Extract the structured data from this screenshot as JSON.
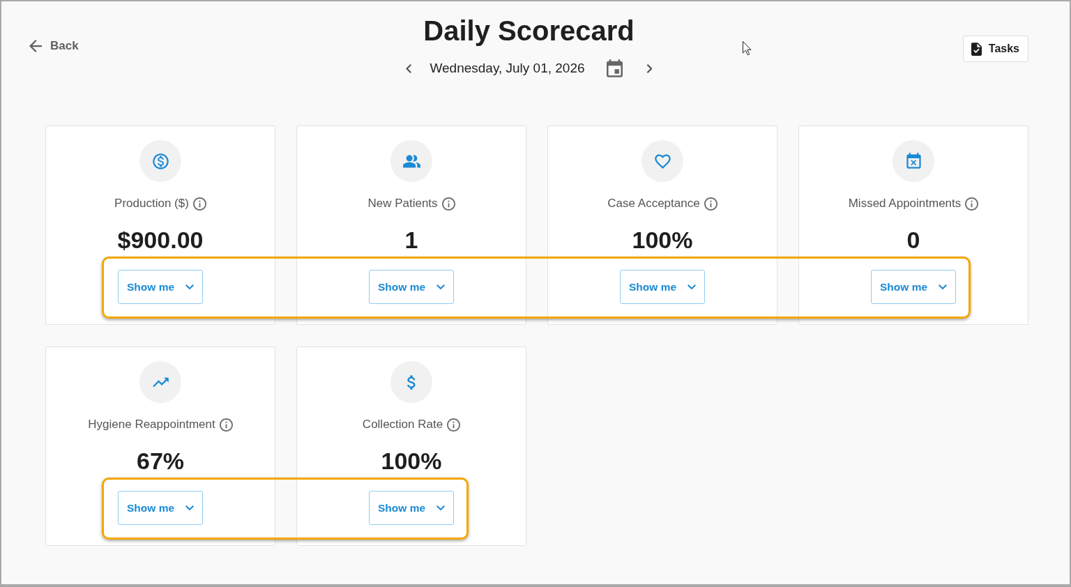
{
  "header": {
    "back_label": "Back",
    "title": "Daily Scorecard",
    "date": "Wednesday, July 01, 2026",
    "tasks_label": "Tasks"
  },
  "rows": [
    {
      "highlighted": true,
      "cards": [
        {
          "kind": "production",
          "label": "Production ($)",
          "value": "$900.00",
          "button": "Show me"
        },
        {
          "kind": "patients",
          "label": "New Patients",
          "value": "1",
          "button": "Show me"
        },
        {
          "kind": "acceptance",
          "label": "Case Acceptance",
          "value": "100%",
          "button": "Show me"
        },
        {
          "kind": "missed",
          "label": "Missed Appointments",
          "value": "0",
          "button": "Show me"
        }
      ]
    },
    {
      "highlighted": true,
      "cards": [
        {
          "kind": "reappointment",
          "label": "Hygiene Reappointment",
          "value": "67%",
          "button": "Show me"
        },
        {
          "kind": "collection",
          "label": "Collection Rate",
          "value": "100%",
          "button": "Show me"
        }
      ]
    }
  ]
}
